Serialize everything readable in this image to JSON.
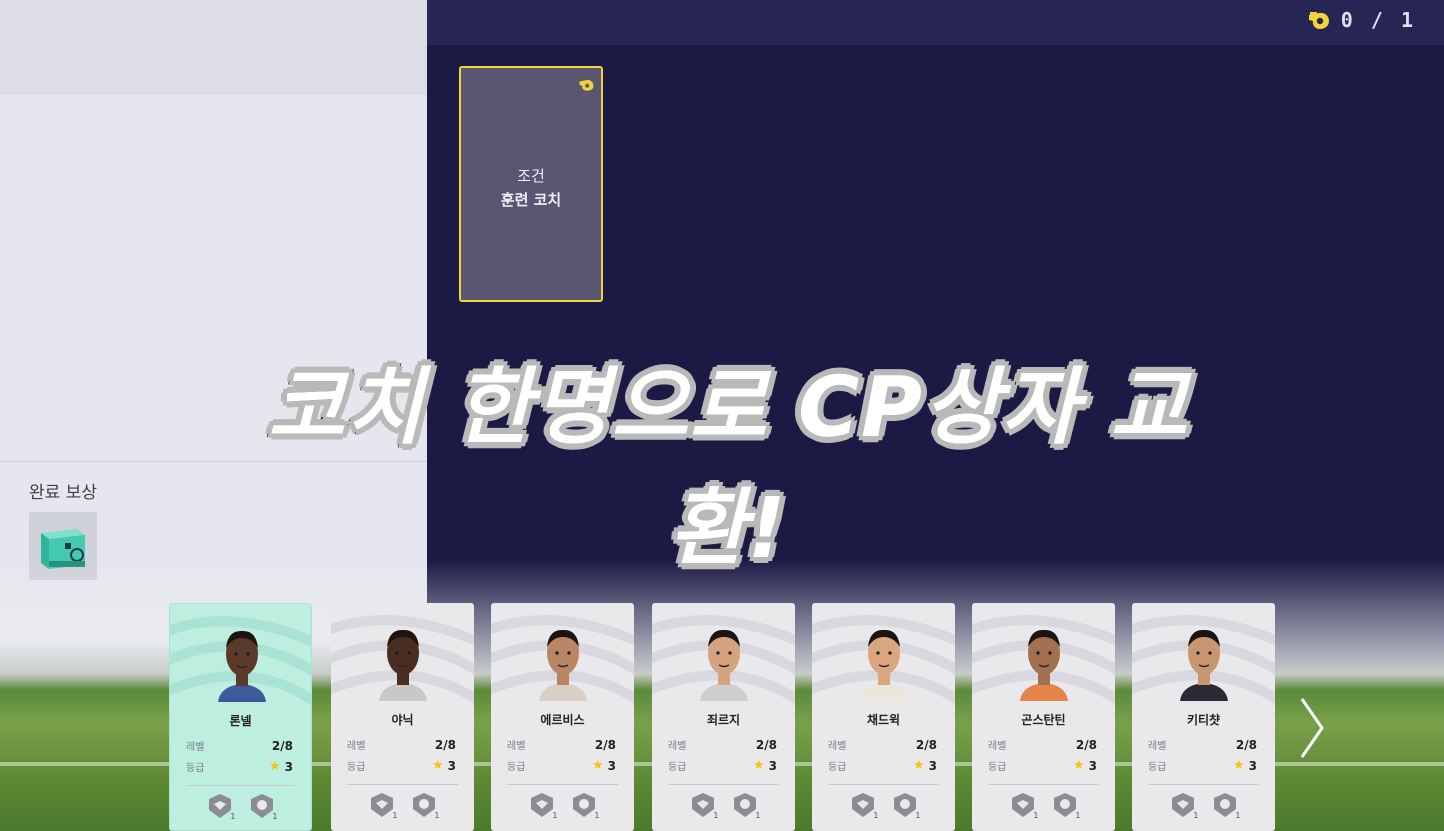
{
  "header": {
    "coach_counter": "0 / 1",
    "whistle_icon": "whistle-icon",
    "accent": "#f2d43a"
  },
  "condition_card": {
    "line1": "조건",
    "line2": "훈련 코치"
  },
  "reward": {
    "title": "완료 보상",
    "item_icon": "cp-box-icon"
  },
  "caption": "코치 한명으로 CP상자 교환!",
  "labels": {
    "level": "레벨",
    "grade": "등급"
  },
  "coaches": [
    {
      "name": "론넬",
      "level": "2/8",
      "grade": "3",
      "selected": true
    },
    {
      "name": "야닉",
      "level": "2/8",
      "grade": "3",
      "selected": false
    },
    {
      "name": "에르비스",
      "level": "2/8",
      "grade": "3",
      "selected": false
    },
    {
      "name": "죄르지",
      "level": "2/8",
      "grade": "3",
      "selected": false
    },
    {
      "name": "채드윅",
      "level": "2/8",
      "grade": "3",
      "selected": false
    },
    {
      "name": "곤스탄틴",
      "level": "2/8",
      "grade": "3",
      "selected": false
    },
    {
      "name": "키티챳",
      "level": "2/8",
      "grade": "3",
      "selected": false
    }
  ],
  "skill_level": "1",
  "next_icon": "chevron-right-icon"
}
